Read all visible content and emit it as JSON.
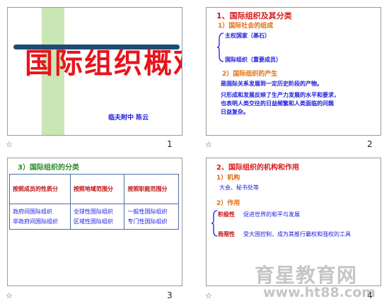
{
  "slides": [
    {
      "num": "1",
      "title": "国际组织概观",
      "author": "临夫附中    陈云"
    },
    {
      "num": "2",
      "heading": "1、国际组织及其分类",
      "sub1": "1）国际社会的组成",
      "brace_a": "主权国家（基石）",
      "brace_b": "国际组织（重要成员）",
      "sub2": "2）国际组织的产生",
      "line1": "是国际关系发展到一定历史阶段的产物。",
      "line2": "只形成和发展反映了生产力发展的水平和要求，",
      "line3": "也表明人类交往的日益频繁和人类面临的问题",
      "line4": "日益复杂。"
    },
    {
      "num": "3",
      "heading": "3）国际组织的分类",
      "columns": [
        "按照成员的性质分",
        "按照地域范围分",
        "按照职能范围分"
      ],
      "rows": [
        [
          "政府间国际组织",
          "全球性国际组织",
          "一般性国际组织"
        ],
        [
          "非政府间国际组织",
          "区域性国际组织",
          "专门性国际组织"
        ]
      ]
    },
    {
      "num": "4",
      "heading": "2、国际组织的机构和作用",
      "sub1": "1）机构",
      "body1": "大会、秘书处等",
      "sub2": "2）作用",
      "role_a_label": "积极性",
      "role_a_text": "促进世界的和平与发展",
      "role_b_label": "局限性",
      "role_b_text": "受大国控制，成为其推行霸权和强权的工具"
    }
  ],
  "watermark": {
    "brand": "育星教育网",
    "url": "www.ht88.com"
  },
  "star_glyph": "☆"
}
